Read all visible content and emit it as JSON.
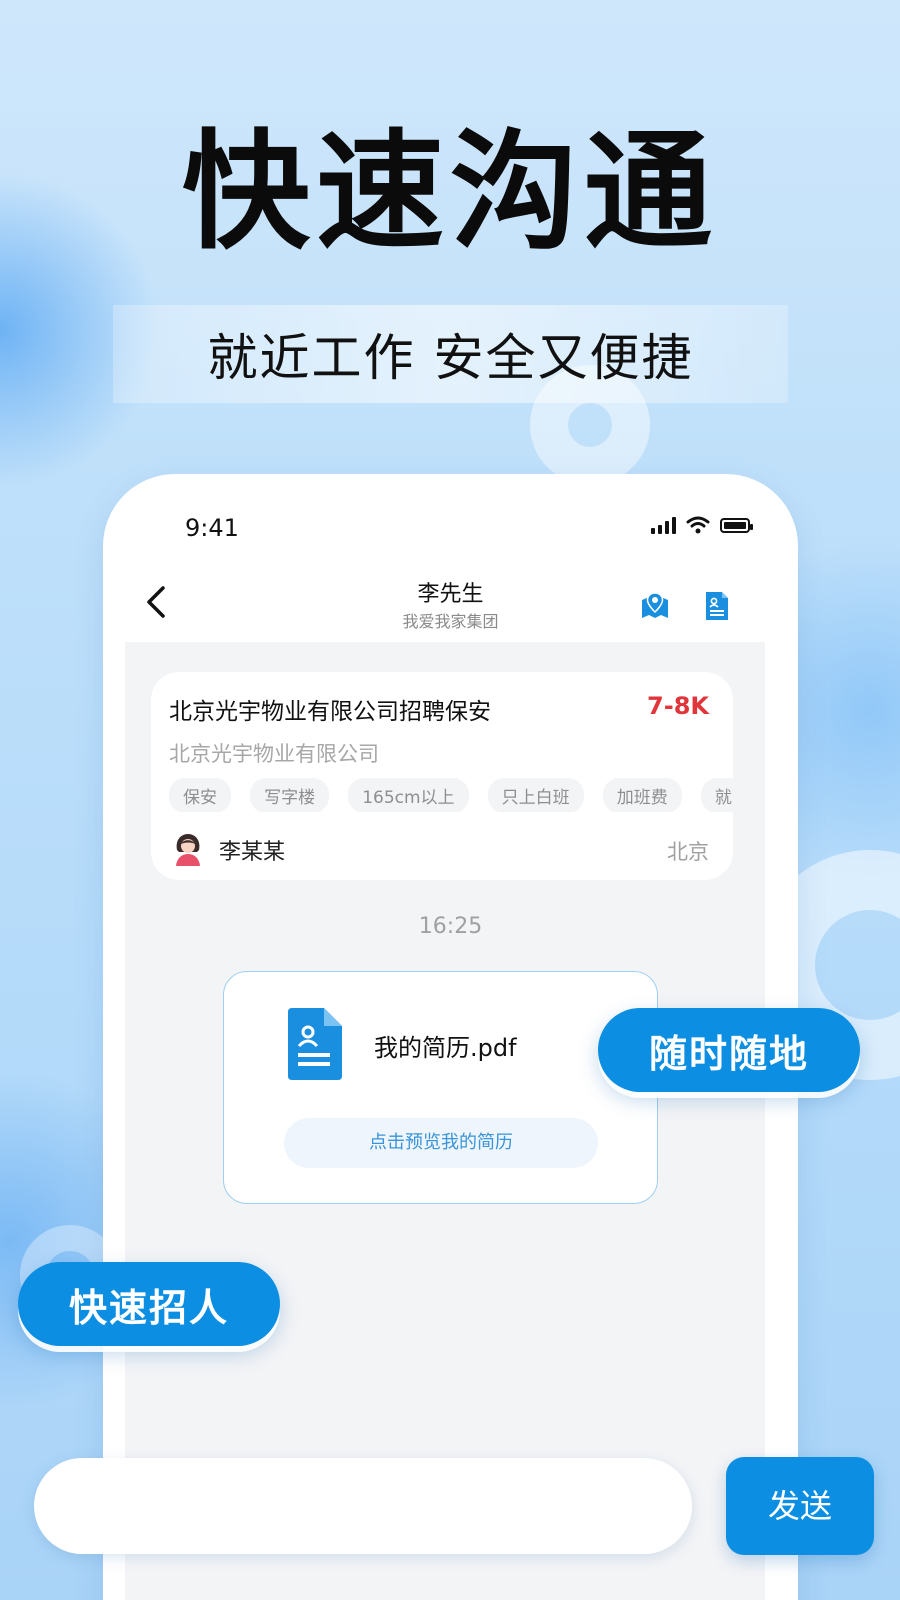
{
  "promo": {
    "headline": "快速沟通",
    "subtitle": "就近工作 安全又便捷",
    "badge_anywhere": "随时随地",
    "badge_hire": "快速招人"
  },
  "status_bar": {
    "time": "9:41"
  },
  "chat_header": {
    "contact_name": "李先生",
    "contact_company": "我爱我家集团",
    "icons": [
      "back-arrow-icon",
      "map-pin-icon",
      "resume-icon"
    ]
  },
  "job_card": {
    "title": "北京光宇物业有限公司招聘保安",
    "salary": "7-8K",
    "company": "北京光宇物业有限公司",
    "tags": [
      "保安",
      "写字楼",
      "165cm以上",
      "只上白班",
      "加班费",
      "就"
    ],
    "poster_name": "李某某",
    "city": "北京"
  },
  "chat": {
    "timestamp": "16:25",
    "file_message": {
      "file_name": "我的简历.pdf",
      "preview_label": "点击预览我的简历"
    }
  },
  "composer": {
    "input_value": "",
    "send_label": "发送"
  },
  "colors": {
    "accent": "#0c8ee2",
    "salary_red": "#e0363b",
    "background": "#bfe0fa"
  }
}
